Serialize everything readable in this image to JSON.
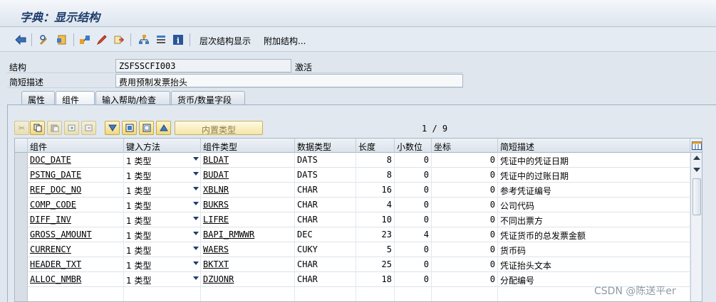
{
  "window": {
    "title": "字典：显示结构"
  },
  "toolbar": {
    "icons": [
      "back-icon",
      "display-change-icon",
      "other-object-icon",
      "where-used-icon",
      "edit-icon",
      "navigate-icon",
      "hierarchy-icon",
      "list-icon",
      "info-icon"
    ],
    "hierarchy_label": "层次结构显示",
    "append_label": "附加结构..."
  },
  "header": {
    "structure_label": "结构",
    "structure_value": "ZSFSSCFI003",
    "status": "激活",
    "desc_label": "简短描述",
    "desc_value": "费用预制发票抬头"
  },
  "tabs": [
    {
      "label": "属性"
    },
    {
      "label": "组件"
    },
    {
      "label": "输入帮助/检查"
    },
    {
      "label": "货币/数量字段"
    }
  ],
  "table_toolbar": {
    "builtin_type_label": "内置类型",
    "pager": "1 / 9"
  },
  "table": {
    "columns": [
      "组件",
      "键入方法",
      "组件类型",
      "数据类型",
      "长度",
      "小数位",
      "坐标",
      "简短描述"
    ],
    "rows": [
      {
        "component": "DOC_DATE",
        "method": "1 类型",
        "ctype": "BLDAT",
        "dtype": "DATS",
        "length": "8",
        "decimals": "0",
        "coord": "0",
        "desc": "凭证中的凭证日期"
      },
      {
        "component": "PSTNG_DATE",
        "method": "1 类型",
        "ctype": "BUDAT",
        "dtype": "DATS",
        "length": "8",
        "decimals": "0",
        "coord": "0",
        "desc": "凭证中的过账日期"
      },
      {
        "component": "REF_DOC_NO",
        "method": "1 类型",
        "ctype": "XBLNR",
        "dtype": "CHAR",
        "length": "16",
        "decimals": "0",
        "coord": "0",
        "desc": "参考凭证编号"
      },
      {
        "component": "COMP_CODE",
        "method": "1 类型",
        "ctype": "BUKRS",
        "dtype": "CHAR",
        "length": "4",
        "decimals": "0",
        "coord": "0",
        "desc": "公司代码"
      },
      {
        "component": "DIFF_INV",
        "method": "1 类型",
        "ctype": "LIFRE",
        "dtype": "CHAR",
        "length": "10",
        "decimals": "0",
        "coord": "0",
        "desc": "不同出票方"
      },
      {
        "component": "GROSS_AMOUNT",
        "method": "1 类型",
        "ctype": "BAPI_RMWWR",
        "dtype": "DEC",
        "length": "23",
        "decimals": "4",
        "coord": "0",
        "desc": "凭证货币的总发票金额"
      },
      {
        "component": "CURRENCY",
        "method": "1 类型",
        "ctype": "WAERS",
        "dtype": "CUKY",
        "length": "5",
        "decimals": "0",
        "coord": "0",
        "desc": "货币码"
      },
      {
        "component": "HEADER_TXT",
        "method": "1 类型",
        "ctype": "BKTXT",
        "dtype": "CHAR",
        "length": "25",
        "decimals": "0",
        "coord": "0",
        "desc": "凭证抬头文本"
      },
      {
        "component": "ALLOC_NMBR",
        "method": "1 类型",
        "ctype": "DZUONR",
        "dtype": "CHAR",
        "length": "18",
        "decimals": "0",
        "coord": "0",
        "desc": "分配编号"
      }
    ]
  },
  "watermark": "CSDN @陈送平er"
}
